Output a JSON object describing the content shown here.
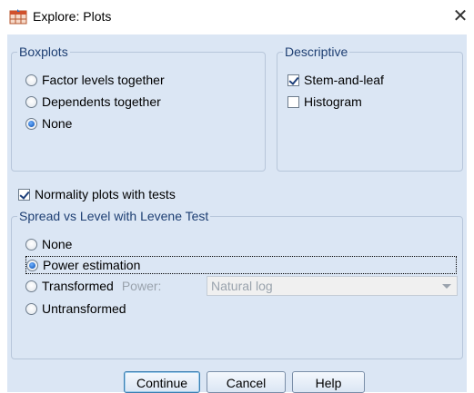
{
  "window": {
    "title": "Explore: Plots",
    "close_glyph": "✕"
  },
  "boxplots": {
    "legend": "Boxplots",
    "options": [
      {
        "label": "Factor levels together",
        "checked": false
      },
      {
        "label": "Dependents together",
        "checked": false
      },
      {
        "label": "None",
        "checked": true
      }
    ]
  },
  "descriptive": {
    "legend": "Descriptive",
    "options": [
      {
        "label": "Stem-and-leaf",
        "checked": true
      },
      {
        "label": "Histogram",
        "checked": false
      }
    ]
  },
  "normality": {
    "label": "Normality plots with tests",
    "checked": true
  },
  "spread": {
    "legend": "Spread vs Level with Levene Test",
    "options": [
      {
        "label": "None",
        "checked": false
      },
      {
        "label": "Power estimation",
        "checked": true
      },
      {
        "label": "Transformed",
        "checked": false
      },
      {
        "label": "Untransformed",
        "checked": false
      }
    ],
    "power_label": "Power:",
    "power_value": "Natural log"
  },
  "buttons": {
    "continue": "Continue",
    "cancel": "Cancel",
    "help": "Help"
  },
  "icons": {
    "app": "spss-table-icon",
    "close": "close-icon"
  },
  "colors": {
    "panel_bg": "#dbe6f4",
    "legend_text": "#1e3f73",
    "accent": "#1a5fbf"
  }
}
